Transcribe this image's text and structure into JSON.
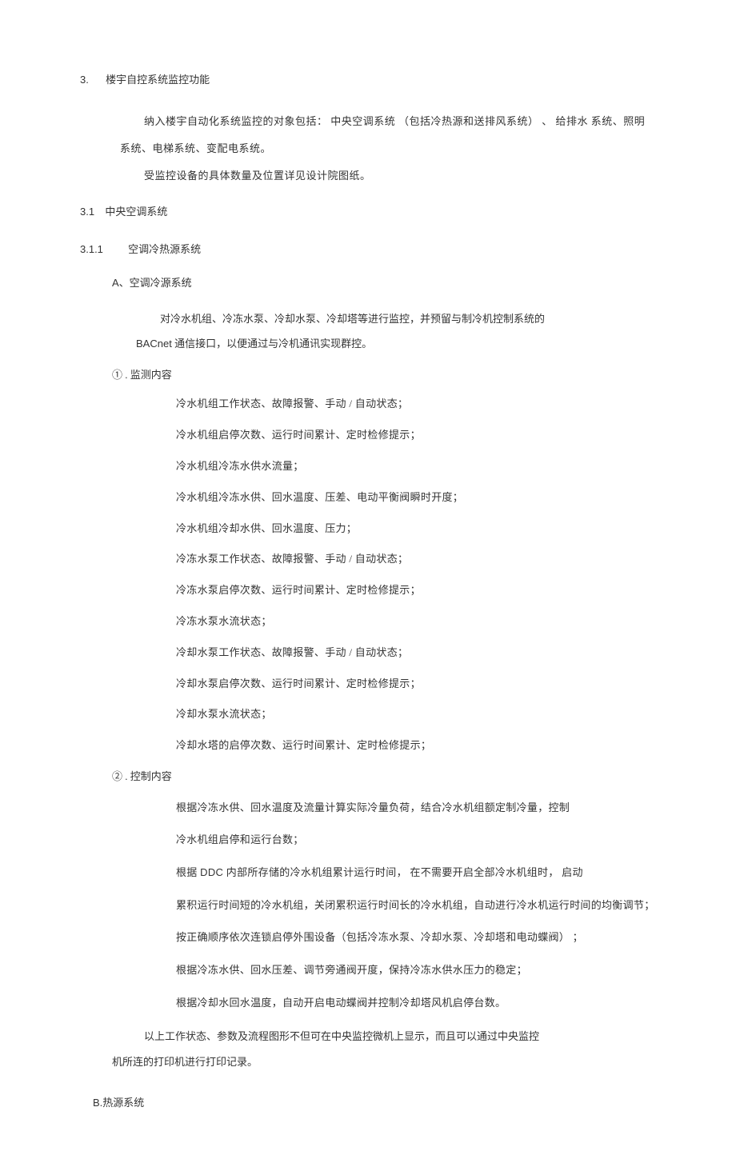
{
  "h1": {
    "num": "3.",
    "text": "楼宇自控系统监控功能"
  },
  "intro": {
    "p1": "纳入楼宇自动化系统监控的对象包括： 中央空调系统 （包括冷热源和送排风系统） 、 给排水 系统、照明",
    "p2": "系统、电梯系统、变配电系统。",
    "p3": "受监控设备的具体数量及位置详见设计院图纸。"
  },
  "h2": {
    "num": "3.1",
    "text": "中央空调系统"
  },
  "h3": {
    "num": "3.1.1",
    "text": "空调冷热源系统"
  },
  "subA": {
    "label": "A",
    "text": "、空调冷源系统"
  },
  "desc": {
    "p1": "对冷水机组、冷冻水泵、冷却水泵、冷却塔等进行监控，并预留与制冷机控制系统的",
    "p2_latin": "BACnet",
    "p2_rest": " 通信接口，以便通过与冷机通讯实现群控。"
  },
  "sec1": {
    "heading": "① . 监测内容",
    "items": [
      "冷水机组工作状态、故障报警、手动 / 自动状态；",
      "冷水机组启停次数、运行时间累计、定时检修提示；",
      "冷水机组冷冻水供水流量；",
      "冷水机组冷冻水供、回水温度、压差、电动平衡阀瞬时开度；",
      "冷水机组冷却水供、回水温度、压力；",
      "冷冻水泵工作状态、故障报警、手动 / 自动状态；",
      "冷冻水泵启停次数、运行时间累计、定时检修提示；",
      "冷冻水泵水流状态；",
      "冷却水泵工作状态、故障报警、手动 / 自动状态；",
      "冷却水泵启停次数、运行时间累计、定时检修提示；",
      "冷却水泵水流状态；",
      "冷却水塔的启停次数、运行时间累计、定时检修提示；"
    ]
  },
  "sec2": {
    "heading": "② . 控制内容",
    "items": [
      "根据冷冻水供、回水温度及流量计算实际冷量负荷，结合冷水机组额定制冷量，控制",
      "冷水机组启停和运行台数；",
      "根据 DDC 内部所存储的冷水机组累计运行时间， 在不需要开启全部冷水机组时， 启动",
      "累积运行时间短的冷水机组，关闭累积运行时间长的冷水机组，自动进行冷水机运行时间的均衡调节；",
      "按正确顺序依次连锁启停外围设备（包括冷冻水泵、冷却水泵、冷却塔和电动蝶阀） ；",
      "根据冷冻水供、回水压差、调节旁通阀开度，保持冷冻水供水压力的稳定；",
      "根据冷却水回水温度，自动开启电动蝶阀并控制冷却塔风机启停台数。"
    ]
  },
  "summary": {
    "p1": "以上工作状态、参数及流程图形不但可在中央监控微机上显示，而且可以通过中央监控",
    "p2": "机所连的打印机进行打印记录。"
  },
  "subB": {
    "label": "B.",
    "text": "热源系统"
  }
}
